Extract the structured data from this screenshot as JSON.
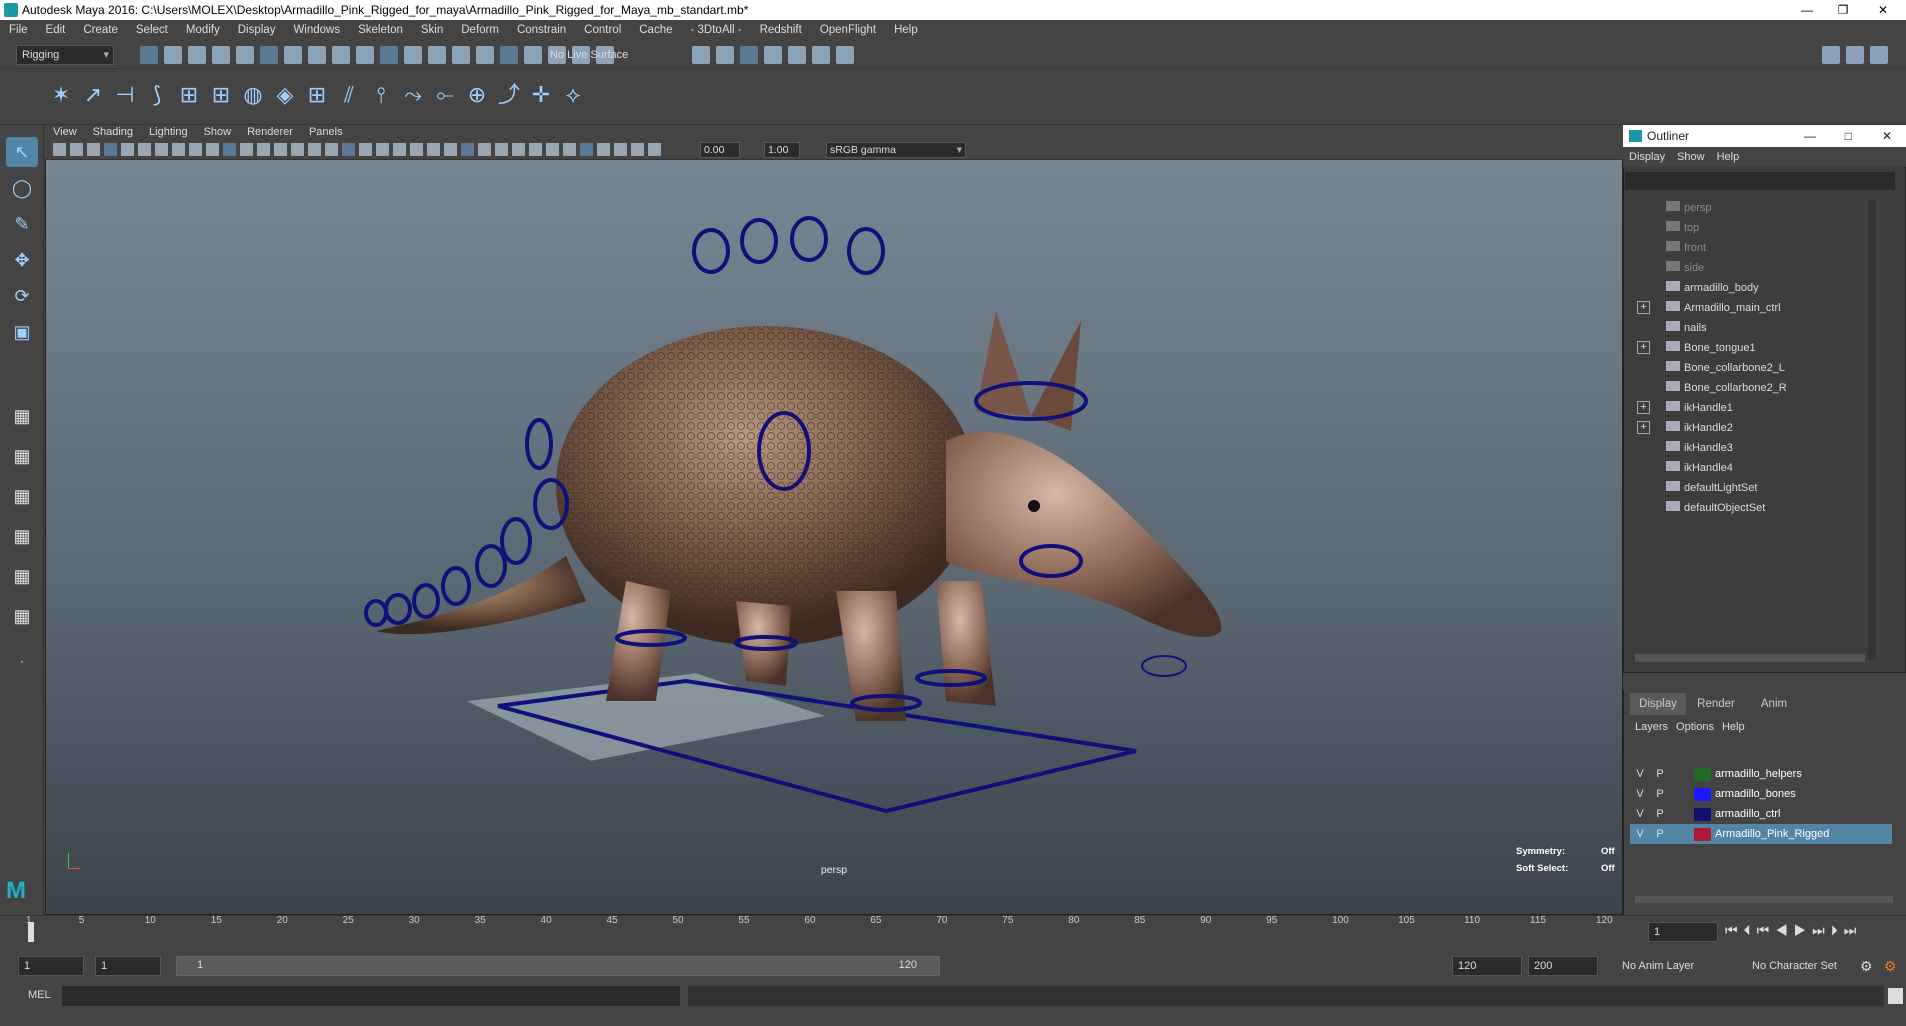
{
  "window": {
    "title": "Autodesk Maya 2016: C:\\Users\\MOLEX\\Desktop\\Armadillo_Pink_Rigged_for_maya\\Armadillo_Pink_Rigged_for_Maya_mb_standart.mb*"
  },
  "menubar": [
    "File",
    "Edit",
    "Create",
    "Select",
    "Modify",
    "Display",
    "Windows",
    "Skeleton",
    "Skin",
    "Deform",
    "Constrain",
    "Control",
    "Cache",
    "- 3DtoAll -",
    "Redshift",
    "OpenFlight",
    "Help"
  ],
  "shelf": {
    "mode": "Rigging",
    "live_surface": "No Live Surface"
  },
  "viewport": {
    "menu": [
      "View",
      "Shading",
      "Lighting",
      "Show",
      "Renderer",
      "Panels"
    ],
    "near_value": "0.00",
    "far_value": "1.00",
    "color_space": "sRGB gamma",
    "camera_label": "persp",
    "symmetry_label": "Symmetry:",
    "symmetry_value": "Off",
    "soft_select_label": "Soft Select:",
    "soft_select_value": "Off"
  },
  "outliner": {
    "title": "Outliner",
    "menu": [
      "Display",
      "Show",
      "Help"
    ],
    "items": [
      {
        "label": "persp",
        "dim": true,
        "expand": false
      },
      {
        "label": "top",
        "dim": true,
        "expand": false
      },
      {
        "label": "front",
        "dim": true,
        "expand": false
      },
      {
        "label": "side",
        "dim": true,
        "expand": false
      },
      {
        "label": "armadillo_body",
        "dim": false,
        "expand": false
      },
      {
        "label": "Armadillo_main_ctrl",
        "dim": false,
        "expand": true
      },
      {
        "label": "nails",
        "dim": false,
        "expand": false
      },
      {
        "label": "Bone_tongue1",
        "dim": false,
        "expand": true
      },
      {
        "label": "Bone_collarbone2_L",
        "dim": false,
        "expand": false
      },
      {
        "label": "Bone_collarbone2_R",
        "dim": false,
        "expand": false
      },
      {
        "label": "ikHandle1",
        "dim": false,
        "expand": true
      },
      {
        "label": "ikHandle2",
        "dim": false,
        "expand": true
      },
      {
        "label": "ikHandle3",
        "dim": false,
        "expand": false
      },
      {
        "label": "ikHandle4",
        "dim": false,
        "expand": false
      },
      {
        "label": "defaultLightSet",
        "dim": false,
        "expand": false
      },
      {
        "label": "defaultObjectSet",
        "dim": false,
        "expand": false
      }
    ]
  },
  "layer_editor": {
    "tabs": [
      "Display",
      "Render",
      "Anim"
    ],
    "menu": [
      "Layers",
      "Options",
      "Help"
    ],
    "layers": [
      {
        "v": "V",
        "p": "P",
        "color": "#1f6a2a",
        "name": "armadillo_helpers",
        "selected": false
      },
      {
        "v": "V",
        "p": "P",
        "color": "#1a1aff",
        "name": "armadillo_bones",
        "selected": false
      },
      {
        "v": "V",
        "p": "P",
        "color": "#10106e",
        "name": "armadillo_ctrl",
        "selected": false
      },
      {
        "v": "V",
        "p": "P",
        "color": "#b0183a",
        "name": "Armadillo_Pink_Rigged",
        "selected": true
      }
    ]
  },
  "timeline": {
    "ticks": [
      "1",
      "5",
      "10",
      "15",
      "20",
      "25",
      "30",
      "35",
      "40",
      "45",
      "50",
      "55",
      "60",
      "65",
      "70",
      "75",
      "80",
      "85",
      "90",
      "95",
      "100",
      "105",
      "110",
      "115",
      "120"
    ],
    "current_frame": "1"
  },
  "range": {
    "start": "1",
    "inner_start": "1",
    "slider_start": "1",
    "slider_end": "120",
    "end": "120",
    "outer_end": "200",
    "anim_layer": "No Anim Layer",
    "char_set": "No Character Set"
  },
  "commandline": {
    "label": "MEL"
  }
}
